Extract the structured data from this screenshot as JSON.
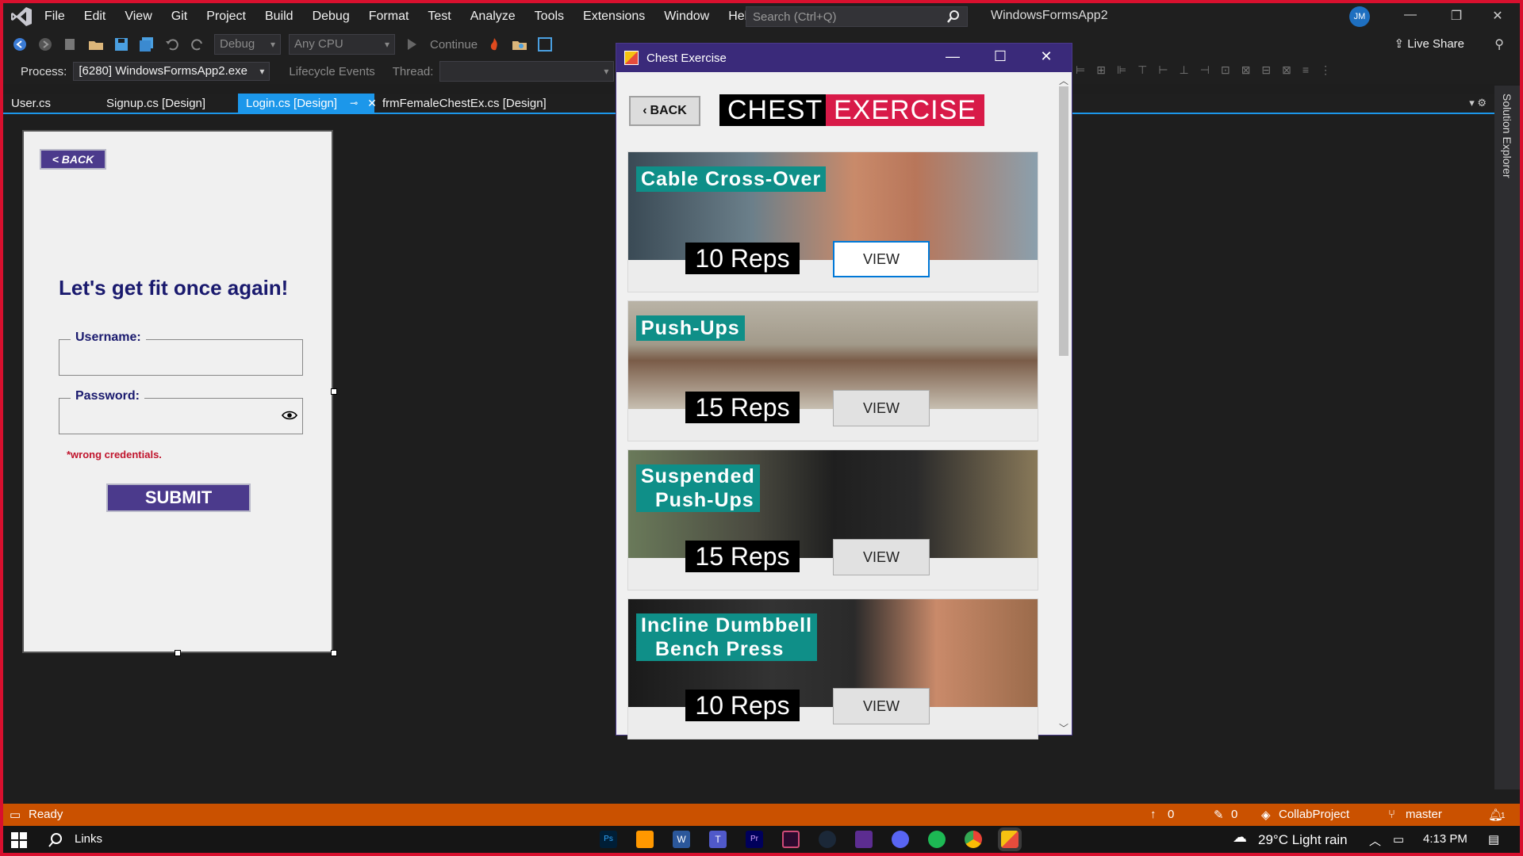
{
  "ide": {
    "menu": [
      "File",
      "Edit",
      "View",
      "Git",
      "Project",
      "Build",
      "Debug",
      "Format",
      "Test",
      "Analyze",
      "Tools",
      "Extensions",
      "Window",
      "Help"
    ],
    "search_placeholder": "Search (Ctrl+Q)",
    "solution_name": "WindowsFormsApp2",
    "user_initials": "JM",
    "toolbar": {
      "config": "Debug",
      "platform": "Any CPU",
      "continue_label": "Continue",
      "live_share": "Live Share"
    },
    "process_bar": {
      "process_label": "Process:",
      "process_value": "[6280] WindowsFormsApp2.exe",
      "lifecycle_label": "Lifecycle Events",
      "thread_label": "Thread:"
    },
    "tabs": [
      {
        "label": "User.cs"
      },
      {
        "label": "Signup.cs [Design]"
      },
      {
        "label": "Login.cs [Design]"
      },
      {
        "label": "frmFemaleChestEx.cs [Design]"
      }
    ],
    "solution_explorer_label": "Solution Explorer"
  },
  "login_form": {
    "back_label": "< BACK",
    "heading": "Let's get fit once again!",
    "username_label": "Username:",
    "password_label": "Password:",
    "error_text": "*wrong credentials.",
    "submit_label": "SUBMIT"
  },
  "chest_window": {
    "title": "Chest Exercise",
    "back_label": "BACK",
    "logo_word1": "CHEST",
    "logo_word2": "EXERCISE",
    "exercises": [
      {
        "name": "Cable Cross-Over",
        "reps": "10 Reps",
        "view_label": "VIEW"
      },
      {
        "name": "Push-Ups",
        "reps": "15 Reps",
        "view_label": "VIEW"
      },
      {
        "name_line1": "Suspended",
        "name_line2": "Push-Ups",
        "reps": "15 Reps",
        "view_label": "VIEW"
      },
      {
        "name_line1": "Incline Dumbbell",
        "name_line2": "Bench Press",
        "reps": "10 Reps",
        "view_label": "VIEW"
      }
    ]
  },
  "status_bar": {
    "state": "Ready",
    "up_count": "0",
    "edit_count": "0",
    "project": "CollabProject",
    "branch": "master",
    "notification_count": "1"
  },
  "taskbar": {
    "links_label": "Links",
    "weather": "29°C  Light rain",
    "time": "4:13 PM",
    "apps": [
      "photoshop-icon",
      "sublime-icon",
      "word-icon",
      "teams-icon",
      "premiere-icon",
      "visual-studio-code-icon",
      "steam-icon",
      "visual-studio-icon",
      "discord-icon",
      "spotify-icon",
      "chrome-icon",
      "winforms-app-icon"
    ]
  },
  "colors": {
    "accent_blue": "#1c97ea",
    "status_orange": "#ca5100",
    "form_purple": "#4b3a8c",
    "teal_label": "#0f8f88",
    "exercise_red": "#d81a48"
  }
}
